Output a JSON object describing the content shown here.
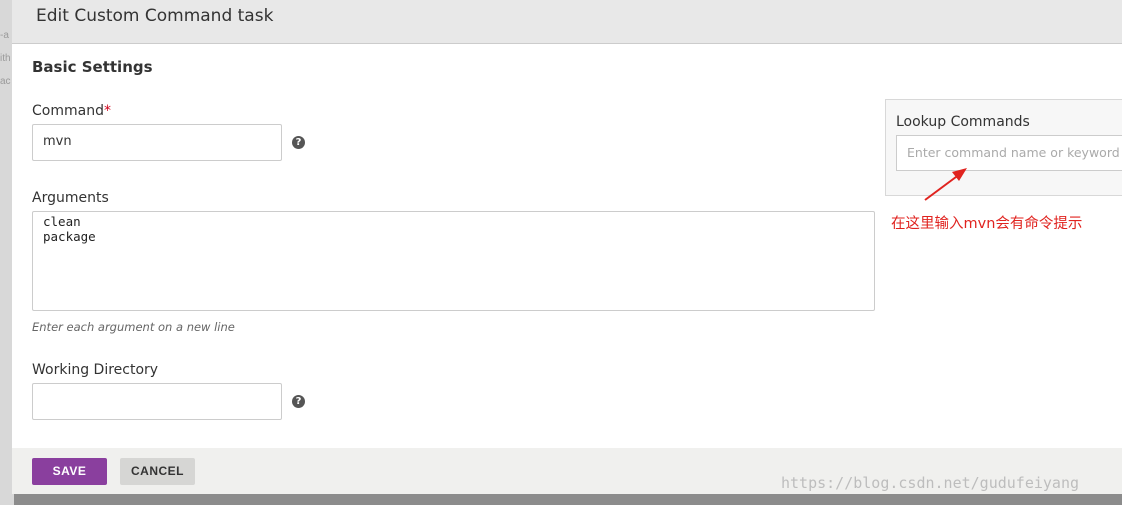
{
  "backdrop": {
    "fragments": [
      "-a",
      "ith",
      "ac"
    ]
  },
  "dialog": {
    "title": "Edit Custom Command task",
    "section_title": "Basic Settings",
    "command": {
      "label": "Command",
      "required_mark": "*",
      "value": "mvn",
      "help_icon": "question-circle-icon"
    },
    "arguments": {
      "label": "Arguments",
      "lines": [
        "clean",
        "package"
      ],
      "hint": "Enter each argument on a new line"
    },
    "working_directory": {
      "label": "Working Directory",
      "value": "",
      "help_icon": "question-circle-icon"
    },
    "lookup": {
      "label": "Lookup Commands",
      "placeholder": "Enter command name or keyword"
    },
    "annotation": {
      "text": "在这里输入mvn会有命令提示",
      "color": "#e0231f"
    },
    "footer": {
      "save_label": "SAVE",
      "cancel_label": "CANCEL"
    }
  },
  "colors": {
    "accent": "#8a3f9e",
    "required": "#d0021b"
  },
  "watermark": "https://blog.csdn.net/gudufeiyang"
}
